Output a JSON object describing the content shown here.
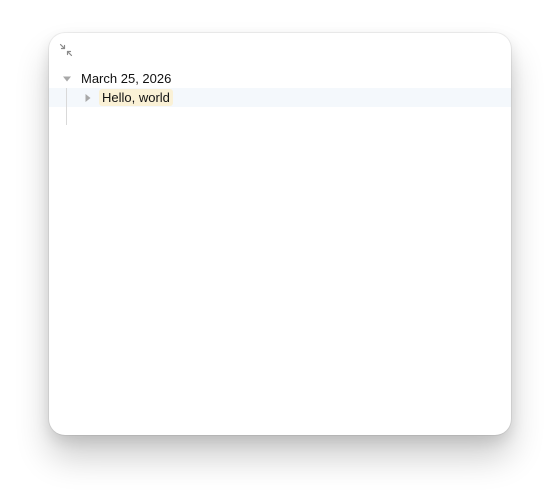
{
  "toolbar": {
    "collapse_icon": "arrows-collapse-icon"
  },
  "tree": {
    "root": {
      "label": "March 25, 2026",
      "expanded": true,
      "disclosure_icon": "triangle-down-icon"
    },
    "children": [
      {
        "label": "Hello, world",
        "expanded": false,
        "selected": true,
        "disclosure_icon": "triangle-right-icon"
      }
    ]
  },
  "colors": {
    "highlight": "#faf1d6",
    "row_selected_bg": "#f4f8fc",
    "disclosure": "#a8a8a8",
    "guide_line": "#d9d9d9"
  }
}
